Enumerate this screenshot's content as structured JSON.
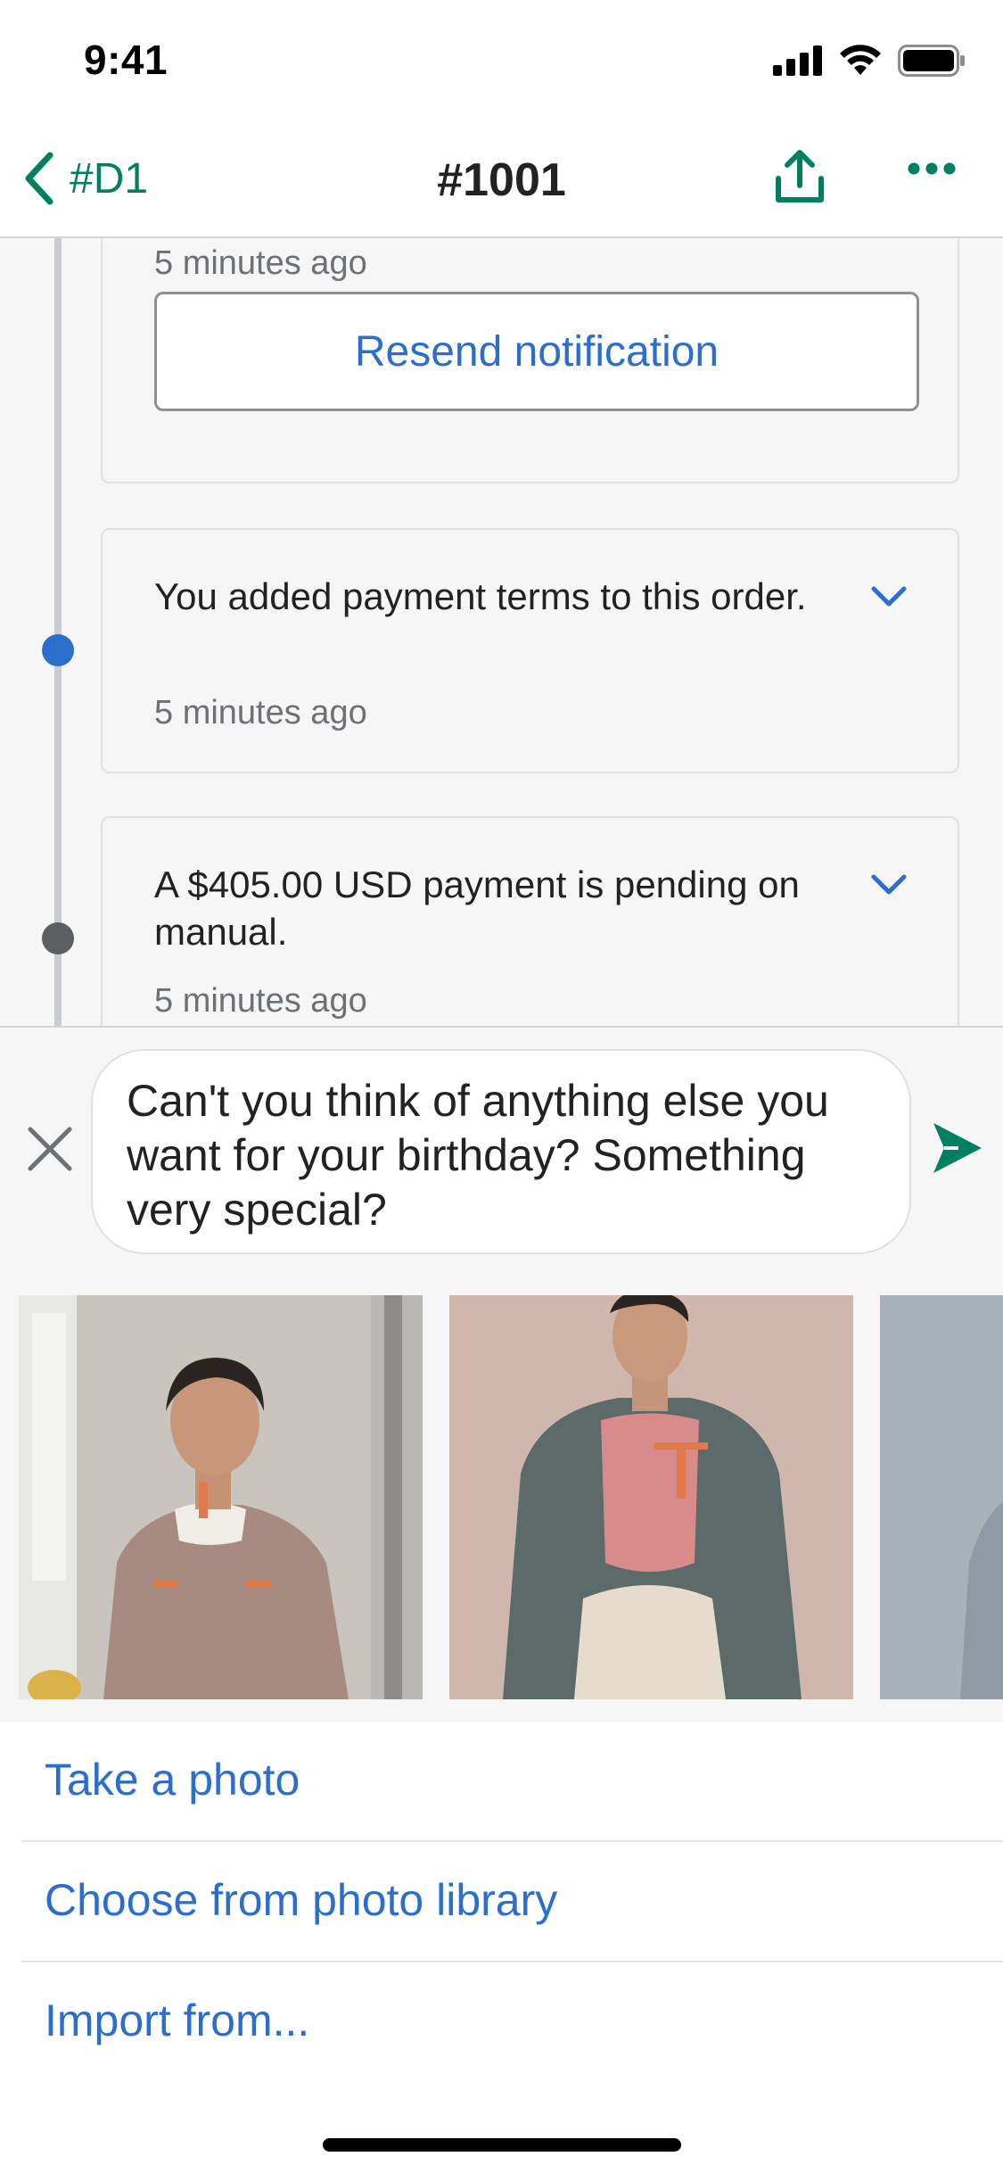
{
  "status_bar": {
    "time": "9:41"
  },
  "nav": {
    "back_label": "#D1",
    "title": "#1001"
  },
  "timeline": {
    "card1": {
      "time": "5 minutes ago",
      "button_label": "Resend notification"
    },
    "card2": {
      "text": "You added payment terms to this order.",
      "time": "5 minutes ago",
      "dot_color": "#2c6ecb"
    },
    "card3": {
      "text": "A $405.00 USD payment is pending on manual.",
      "time": "5 minutes ago",
      "dot_color": "#5c5f62"
    }
  },
  "composer": {
    "message": "Can't you think of anything else you want for your birthday? Something very special?"
  },
  "photos": [
    {
      "name": "photo-1"
    },
    {
      "name": "photo-2"
    },
    {
      "name": "photo-3"
    }
  ],
  "sheet": {
    "take_photo": "Take a photo",
    "choose_library": "Choose from photo library",
    "import_from": "Import from..."
  },
  "colors": {
    "accent_green": "#008060",
    "link_blue": "#2c6ecb"
  }
}
